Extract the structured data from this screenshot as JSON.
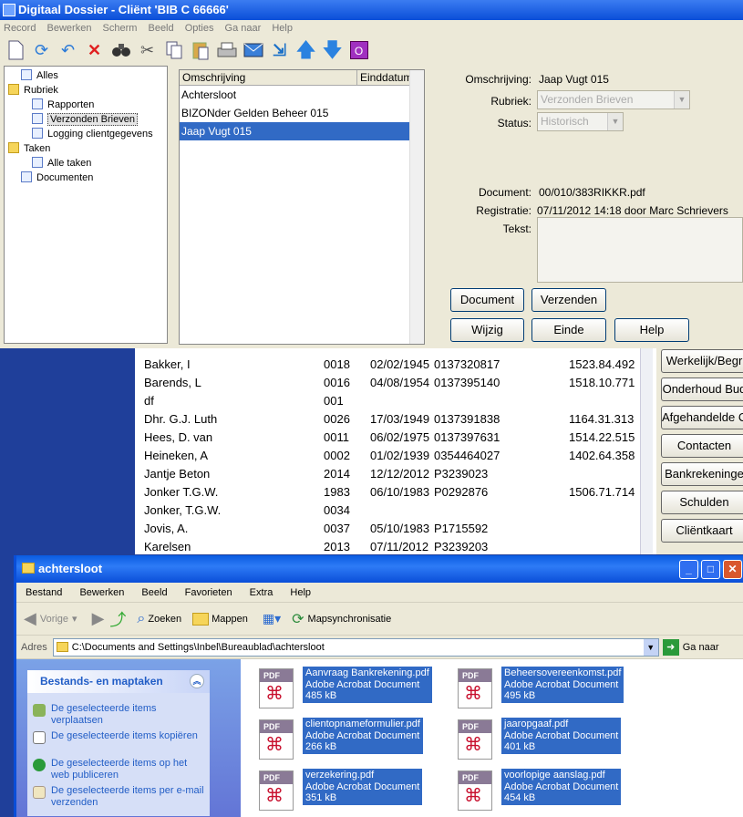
{
  "app": {
    "title": "Digitaal Dossier - Cliënt 'BIB C 66666'",
    "menu": [
      "Record",
      "Bewerken",
      "Scherm",
      "Beeld",
      "Opties",
      "Ga naar",
      "Help"
    ],
    "toolbar_icons": [
      "new-icon",
      "refresh-icon",
      "undo-icon",
      "delete-icon",
      "find-icon",
      "cut-icon",
      "copy-icon",
      "paste-icon",
      "print-icon",
      "mail-icon",
      "export-icon",
      "up-icon",
      "down-icon",
      "object-icon"
    ]
  },
  "tree": {
    "items": [
      {
        "label": "Alles",
        "type": "doc",
        "indent": 0
      },
      {
        "label": "Rubriek",
        "type": "folder",
        "indent": 0
      },
      {
        "label": "Rapporten",
        "type": "doc",
        "indent": 1
      },
      {
        "label": "Verzonden Brieven",
        "type": "doc",
        "indent": 1,
        "selected": true
      },
      {
        "label": "Logging clientgegevens",
        "type": "doc",
        "indent": 1
      },
      {
        "label": "Taken",
        "type": "folder",
        "indent": 0
      },
      {
        "label": "Alle taken",
        "type": "doc",
        "indent": 1
      },
      {
        "label": "Documenten",
        "type": "doc",
        "indent": 0
      }
    ]
  },
  "list": {
    "headers": [
      "Omschrijving",
      "Einddatum"
    ],
    "rows": [
      "Achtersloot",
      "BIZONder Gelden Beheer 015",
      "Jaap Vugt 015"
    ],
    "selected_index": 2
  },
  "detail": {
    "omschrijving_label": "Omschrijving:",
    "omschrijving_value": "Jaap Vugt 015",
    "rubriek_label": "Rubriek:",
    "rubriek_value": "Verzonden Brieven",
    "status_label": "Status:",
    "status_value": "Historisch",
    "document_label": "Document:",
    "document_value": "00/010/383RIKKR.pdf",
    "registratie_label": "Registratie:",
    "registratie_value": "07/11/2012 14:18 door Marc Schrievers",
    "tekst_label": "Tekst:",
    "buttons": {
      "document": "Document",
      "verzenden": "Verzenden",
      "wijzig": "Wijzig",
      "einde": "Einde",
      "help": "Help"
    }
  },
  "clients": {
    "rows": [
      {
        "name": "Bakker, I",
        "code": "0018",
        "date": "02/02/1945",
        "num": "0137320817",
        "amount": "1523.84.492"
      },
      {
        "name": "Barends, L",
        "code": "0016",
        "date": "04/08/1954",
        "num": "0137395140",
        "amount": "1518.10.771"
      },
      {
        "name": "df",
        "code": "001",
        "date": "",
        "num": "",
        "amount": ""
      },
      {
        "name": "Dhr. G.J. Luth",
        "code": "0026",
        "date": "17/03/1949",
        "num": "0137391838",
        "amount": "1164.31.313"
      },
      {
        "name": "Hees, D. van",
        "code": "0011",
        "date": "06/02/1975",
        "num": "0137397631",
        "amount": "1514.22.515"
      },
      {
        "name": "Heineken, A",
        "code": "0002",
        "date": "01/02/1939",
        "num": "0354464027",
        "amount": "1402.64.358"
      },
      {
        "name": "Jantje Beton",
        "code": "2014",
        "date": "12/12/2012",
        "num": "P3239023",
        "amount": ""
      },
      {
        "name": "Jonker T.G.W.",
        "code": "1983",
        "date": "06/10/1983",
        "num": "P0292876",
        "amount": "1506.71.714"
      },
      {
        "name": "Jonker, T.G.W.",
        "code": "0034",
        "date": "",
        "num": "",
        "amount": ""
      },
      {
        "name": "Jovis, A.",
        "code": "0037",
        "date": "05/10/1983",
        "num": "P1715592",
        "amount": ""
      },
      {
        "name": "Karelsen",
        "code": "2013",
        "date": "07/11/2012",
        "num": "P3239203",
        "amount": ""
      }
    ],
    "side_buttons": [
      "Werkelijk/Begr",
      "Onderhoud Bud",
      "Afgehandelde C",
      "Contacten",
      "Bankrekeninge",
      "Schulden",
      "Cliëntkaart"
    ]
  },
  "explorer": {
    "title": "achtersloot",
    "menu": [
      "Bestand",
      "Bewerken",
      "Beeld",
      "Favorieten",
      "Extra",
      "Help"
    ],
    "toolbar": {
      "back": "Vorige",
      "search": "Zoeken",
      "folders": "Mappen",
      "sync": "Mapsynchronisatie"
    },
    "address_label": "Adres",
    "address_value": "C:\\Documents and Settings\\Inbel\\Bureaublad\\achtersloot",
    "go_label": "Ga naar",
    "taskpane": {
      "header": "Bestands- en maptaken",
      "items": [
        "De geselecteerde items verplaatsen",
        "De geselecteerde items kopiëren",
        "De geselecteerde items op het web publiceren",
        "De geselecteerde items per e-mail verzenden"
      ]
    },
    "files": [
      {
        "name": "Aanvraag Bankrekening.pdf",
        "type": "Adobe Acrobat Document",
        "size": "485 kB"
      },
      {
        "name": "Beheersovereenkomst.pdf",
        "type": "Adobe Acrobat Document",
        "size": "495 kB"
      },
      {
        "name": "clientopnameformulier.pdf",
        "type": "Adobe Acrobat Document",
        "size": "266 kB"
      },
      {
        "name": "jaaropgaaf.pdf",
        "type": "Adobe Acrobat Document",
        "size": "401 kB"
      },
      {
        "name": "verzekering.pdf",
        "type": "Adobe Acrobat Document",
        "size": "351 kB"
      },
      {
        "name": "voorlopige aanslag.pdf",
        "type": "Adobe Acrobat Document",
        "size": "454 kB"
      }
    ],
    "pdf_tag": "PDF"
  }
}
